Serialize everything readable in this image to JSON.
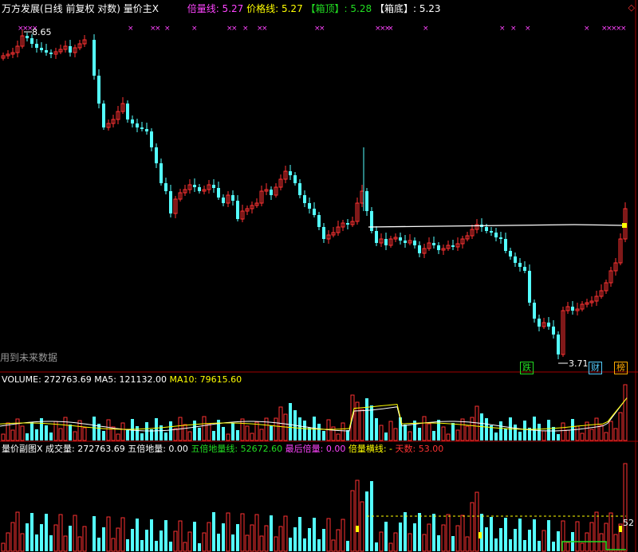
{
  "header": {
    "title": "万方发展(日线 前复权 对数) 量价主X",
    "multiplier_label": "倍量线",
    "multiplier_value": ": 5.27",
    "price_label": "价格线",
    "price_value": ": 5.27",
    "box_top_label": "【箱顶】",
    "box_top_value": ": 5.28",
    "box_bottom_label": "【箱底】",
    "box_bottom_value": ": 5.23"
  },
  "annotations": {
    "high_price": "8.65",
    "low_price": "3.71",
    "future_data": "用到未来数据",
    "tag_die": "跌",
    "tag_cai": "财",
    "tag_bang": "榜"
  },
  "volume_header": {
    "volume": "VOLUME: 272763.69",
    "ma5": "MA5: 121132.00",
    "ma10": "MA10: 79615.60"
  },
  "sub_header": {
    "title": "量价副图X",
    "volume": "成交量: 272763.69",
    "five_low": "五倍地量: 0.00",
    "five_low_line": "五倍地量线: 52672.60",
    "last_mult": "最后倍量: 0.00",
    "mult_line": "倍量横线: -",
    "days": "天数: 53.00"
  },
  "sub_right_value": "52",
  "colors": {
    "up": "#ff3232",
    "down": "#54ffff",
    "magenta": "#ff44ff",
    "green": "#22dd22",
    "yellow": "#ffff00"
  },
  "chart_data": {
    "type": "candlestick",
    "high_label": 8.65,
    "low_label": 3.71,
    "box_top": 5.28,
    "box_bottom": 5.23,
    "volume_last": 272763.69,
    "ma5_last": 121132.0,
    "ma10_last": 79615.6
  }
}
